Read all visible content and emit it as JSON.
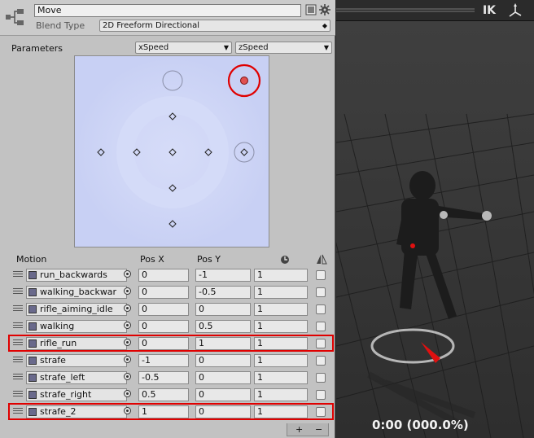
{
  "header": {
    "name_value": "Move",
    "blend_type_label": "Blend Type",
    "blend_type_value": "2D Freeform Directional"
  },
  "parameters": {
    "label": "Parameters",
    "x_param": "xSpeed",
    "y_param": "zSpeed"
  },
  "graph": {
    "points": [
      {
        "x": 0,
        "y": -1,
        "state": "normal"
      },
      {
        "x": 0,
        "y": -0.5,
        "state": "normal"
      },
      {
        "x": 0,
        "y": 0,
        "state": "normal"
      },
      {
        "x": 0,
        "y": 0.5,
        "state": "normal"
      },
      {
        "x": 1,
        "y": 1,
        "state": "selected"
      },
      {
        "x": -1,
        "y": 0,
        "state": "normal"
      },
      {
        "x": -0.5,
        "y": 0,
        "state": "normal"
      },
      {
        "x": 0.5,
        "y": 0,
        "state": "normal"
      },
      {
        "x": 1,
        "y": 0,
        "state": "normal"
      }
    ],
    "xlim": [
      -1,
      1
    ],
    "ylim": [
      -1,
      1
    ],
    "highlight_color": "#e00000"
  },
  "motion_table": {
    "headers": {
      "motion": "Motion",
      "pos_x": "Pos X",
      "pos_y": "Pos Y"
    },
    "rows": [
      {
        "clip": "run_backwards",
        "pos_x": "0",
        "pos_y": "-1",
        "speed": "1",
        "highlighted": false
      },
      {
        "clip": "walking_backwar",
        "pos_x": "0",
        "pos_y": "-0.5",
        "speed": "1",
        "highlighted": false
      },
      {
        "clip": "rifle_aiming_idle",
        "pos_x": "0",
        "pos_y": "0",
        "speed": "1",
        "highlighted": false
      },
      {
        "clip": "walking",
        "pos_x": "0",
        "pos_y": "0.5",
        "speed": "1",
        "highlighted": false
      },
      {
        "clip": "rifle_run",
        "pos_x": "0",
        "pos_y": "1",
        "speed": "1",
        "highlighted": true
      },
      {
        "clip": "strafe",
        "pos_x": "-1",
        "pos_y": "0",
        "speed": "1",
        "highlighted": false
      },
      {
        "clip": "strafe_left",
        "pos_x": "-0.5",
        "pos_y": "0",
        "speed": "1",
        "highlighted": false
      },
      {
        "clip": "strafe_right",
        "pos_x": "0.5",
        "pos_y": "0",
        "speed": "1",
        "highlighted": false
      },
      {
        "clip": "strafe_2",
        "pos_x": "1",
        "pos_y": "0",
        "speed": "1",
        "highlighted": true
      }
    ],
    "add_label": "+",
    "remove_label": "−"
  },
  "scene": {
    "ik_label": "IK",
    "time_label": "0:00 (000.0%)"
  }
}
